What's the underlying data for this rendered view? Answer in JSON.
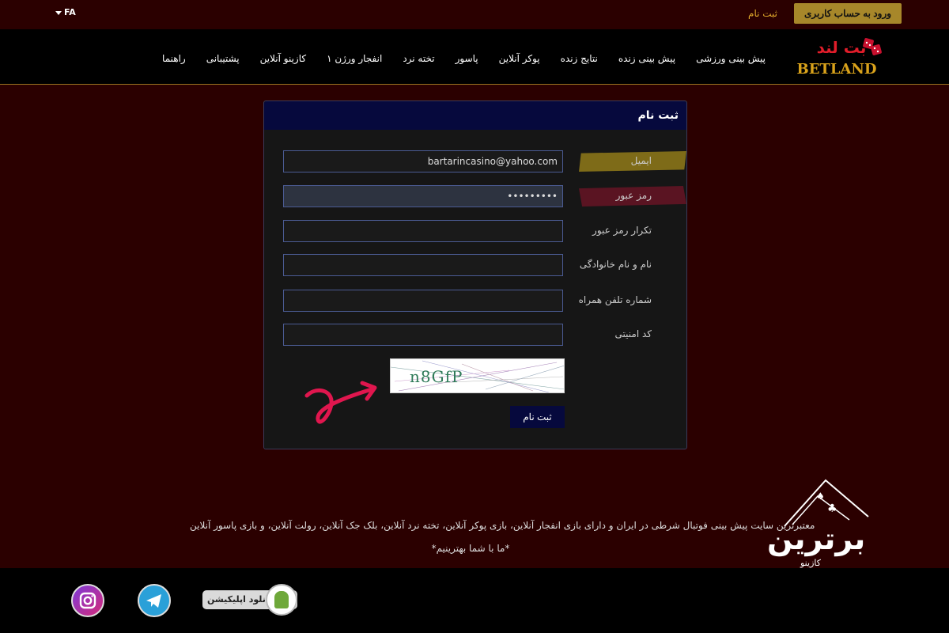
{
  "topbar": {
    "lang": "FA",
    "login_label": "ورود به حساب کاربری",
    "register_label": "ثبت نام"
  },
  "nav": {
    "logo_fa": "بت لند",
    "logo_en": "BETLAND",
    "items": [
      {
        "label": "پیش بینی ورزشی"
      },
      {
        "label": "پیش بینی زنده"
      },
      {
        "label": "نتایج زنده"
      },
      {
        "label": "پوکر آنلاین"
      },
      {
        "label": "پاسور"
      },
      {
        "label": "تخته نرد"
      },
      {
        "label": "انفجار ورژن ۱"
      },
      {
        "label": "کازینو آنلاین"
      },
      {
        "label": "پشتیبانی"
      },
      {
        "label": "راهنما"
      }
    ]
  },
  "form": {
    "title": "ثبت نام",
    "email_label": "ایمیل",
    "email_value": "bartarincasino@yahoo.com",
    "password_label": "رمز عبور",
    "password_value": "•••••••••",
    "confirm_label": "تکرار رمز عبور",
    "confirm_value": "",
    "name_label": "نام و نام خانوادگی",
    "name_value": "",
    "phone_label": "شماره تلفن همراه",
    "phone_value": "",
    "code_label": "کد امنیتی",
    "code_value": "",
    "captcha_text": "n8GfP",
    "submit_label": "ثبت نام"
  },
  "footer": {
    "description": "معتبرترین سایت پیش بینی فوتبال شرطی در ایران و دارای بازی انفجار آنلاین، بازی پوکر آنلاین، تخته نرد آنلاین، بلک جک آنلاین، رولت آنلاین، و بازی پاسور آنلاین",
    "slogan": "*ما با شما بهترینیم*",
    "brand_title": "برترین",
    "brand_sub": "کازینو",
    "app_download": "دانلود اپلیکیشن"
  },
  "colors": {
    "background": "#2b0000",
    "accent_gold": "#a7872a",
    "panel_head": "#06093d",
    "link": "#e0a92b"
  }
}
